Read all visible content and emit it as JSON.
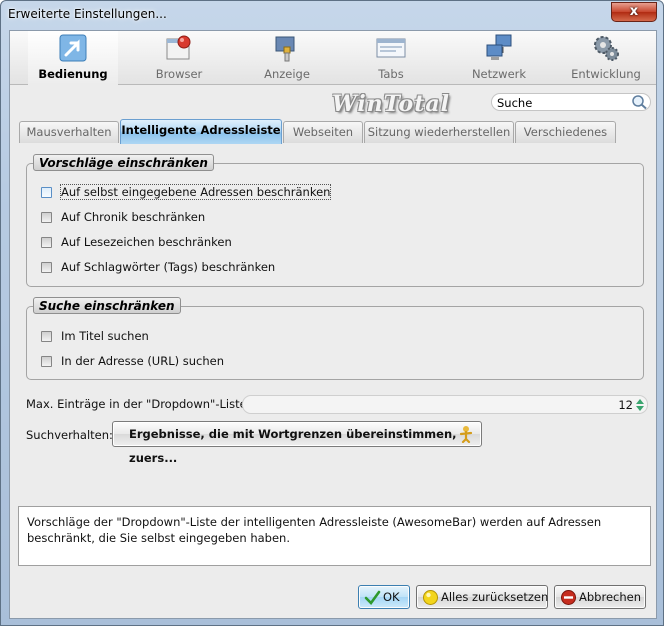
{
  "window": {
    "title": "Erweiterte Einstellungen...",
    "close_glyph": "x"
  },
  "toolbar": {
    "items": [
      {
        "label": "Bedienung",
        "icon": "cursor-arrow-icon",
        "active": true
      },
      {
        "label": "Browser",
        "icon": "browser-globe-icon",
        "active": false
      },
      {
        "label": "Anzeige",
        "icon": "paint-brush-icon",
        "active": false
      },
      {
        "label": "Tabs",
        "icon": "tabs-window-icon",
        "active": false
      },
      {
        "label": "Netzwerk",
        "icon": "network-computers-icon",
        "active": false
      },
      {
        "label": "Entwicklung",
        "icon": "gears-icon",
        "active": false
      }
    ]
  },
  "brand": {
    "text": "WinTotal"
  },
  "search": {
    "value": "Suche"
  },
  "tabs": [
    {
      "label": "Mausverhalten",
      "active": false
    },
    {
      "label": "Intelligente Adressleiste",
      "active": true
    },
    {
      "label": "Webseiten",
      "active": false
    },
    {
      "label": "Sitzung wiederherstellen",
      "active": false
    },
    {
      "label": "Verschiedenes",
      "active": false
    }
  ],
  "group_restrict": {
    "title": "Vorschläge einschränken",
    "options": [
      {
        "label": "Auf selbst eingegebene Adressen beschränken",
        "checked": false
      },
      {
        "label": "Auf Chronik beschränken",
        "checked": false
      },
      {
        "label": "Auf Lesezeichen beschränken",
        "checked": false
      },
      {
        "label": "Auf Schlagwörter (Tags) beschränken",
        "checked": false
      }
    ]
  },
  "group_search": {
    "title": "Suche einschränken",
    "options": [
      {
        "label": "Im Titel suchen",
        "checked": false
      },
      {
        "label": "In der Adresse (URL) suchen",
        "checked": false
      }
    ]
  },
  "max_entries": {
    "label": "Max. Einträge in der \"Dropdown\"-Liste:",
    "value": "12"
  },
  "search_behavior": {
    "label": "Suchverhalten:",
    "value": "Ergebnisse, die mit Wortgrenzen übereinstimmen, zuers..."
  },
  "description": "Vorschläge der \"Dropdown\"-Liste der intelligenten Adressleiste (AwesomeBar) werden auf Adressen beschränkt, die Sie selbst eingegeben haben.",
  "buttons": {
    "ok": "OK",
    "reset": "Alles zurücksetzen",
    "cancel": "Abbrechen"
  },
  "colors": {
    "active_tab": "#a5d2f3",
    "window_frame": "#b7cbe2",
    "ok_check": "#2e9a2e",
    "reset_dot": "#f3d51b",
    "cancel_icon": "#c62d1f"
  }
}
